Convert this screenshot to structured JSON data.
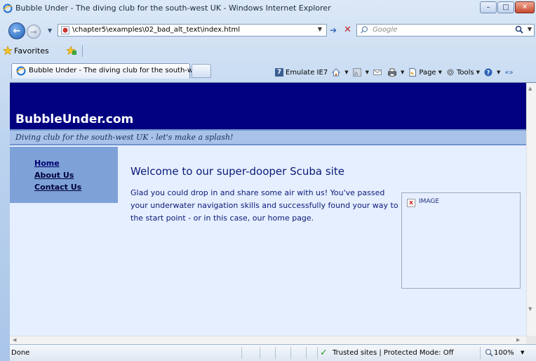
{
  "window": {
    "title": "Bubble Under - The diving club for the south-west UK - Windows Internet Explorer",
    "min_glyph": "–",
    "max_glyph": "□",
    "close_glyph": "✕"
  },
  "address_bar": {
    "url": "\\chapter5\\examples\\02_bad_alt_text\\index.html",
    "search_placeholder": "Google"
  },
  "favorites_bar": {
    "label": "Favorites"
  },
  "tabs": [
    {
      "label": "Bubble Under - The diving club for the south-we..."
    }
  ],
  "command_bar": {
    "emulate_label": "Emulate IE7",
    "page_label": "Page",
    "tools_label": "Tools"
  },
  "site": {
    "title": "BubbleUnder.com",
    "tagline": "Diving club for the south-west UK - let's make a splash!",
    "nav": [
      "Home",
      "About Us",
      "Contact Us"
    ],
    "heading": "Welcome to our super-dooper Scuba site",
    "intro": "Glad you could drop in and share some air with us! You've passed your underwater navigation skills and successfully found your way to the start point - or in this case, our home page.",
    "image_alt": "IMAGE"
  },
  "status_bar": {
    "status": "Done",
    "zone": "Trusted sites | Protected Mode: Off",
    "zoom": "100%"
  },
  "colors": {
    "header_bg": "#000080",
    "tagline_bg": "#a8c2e8",
    "nav_bg": "#7ea2d8",
    "page_bg": "#e6efff",
    "text_blue": "#0a1a78"
  }
}
